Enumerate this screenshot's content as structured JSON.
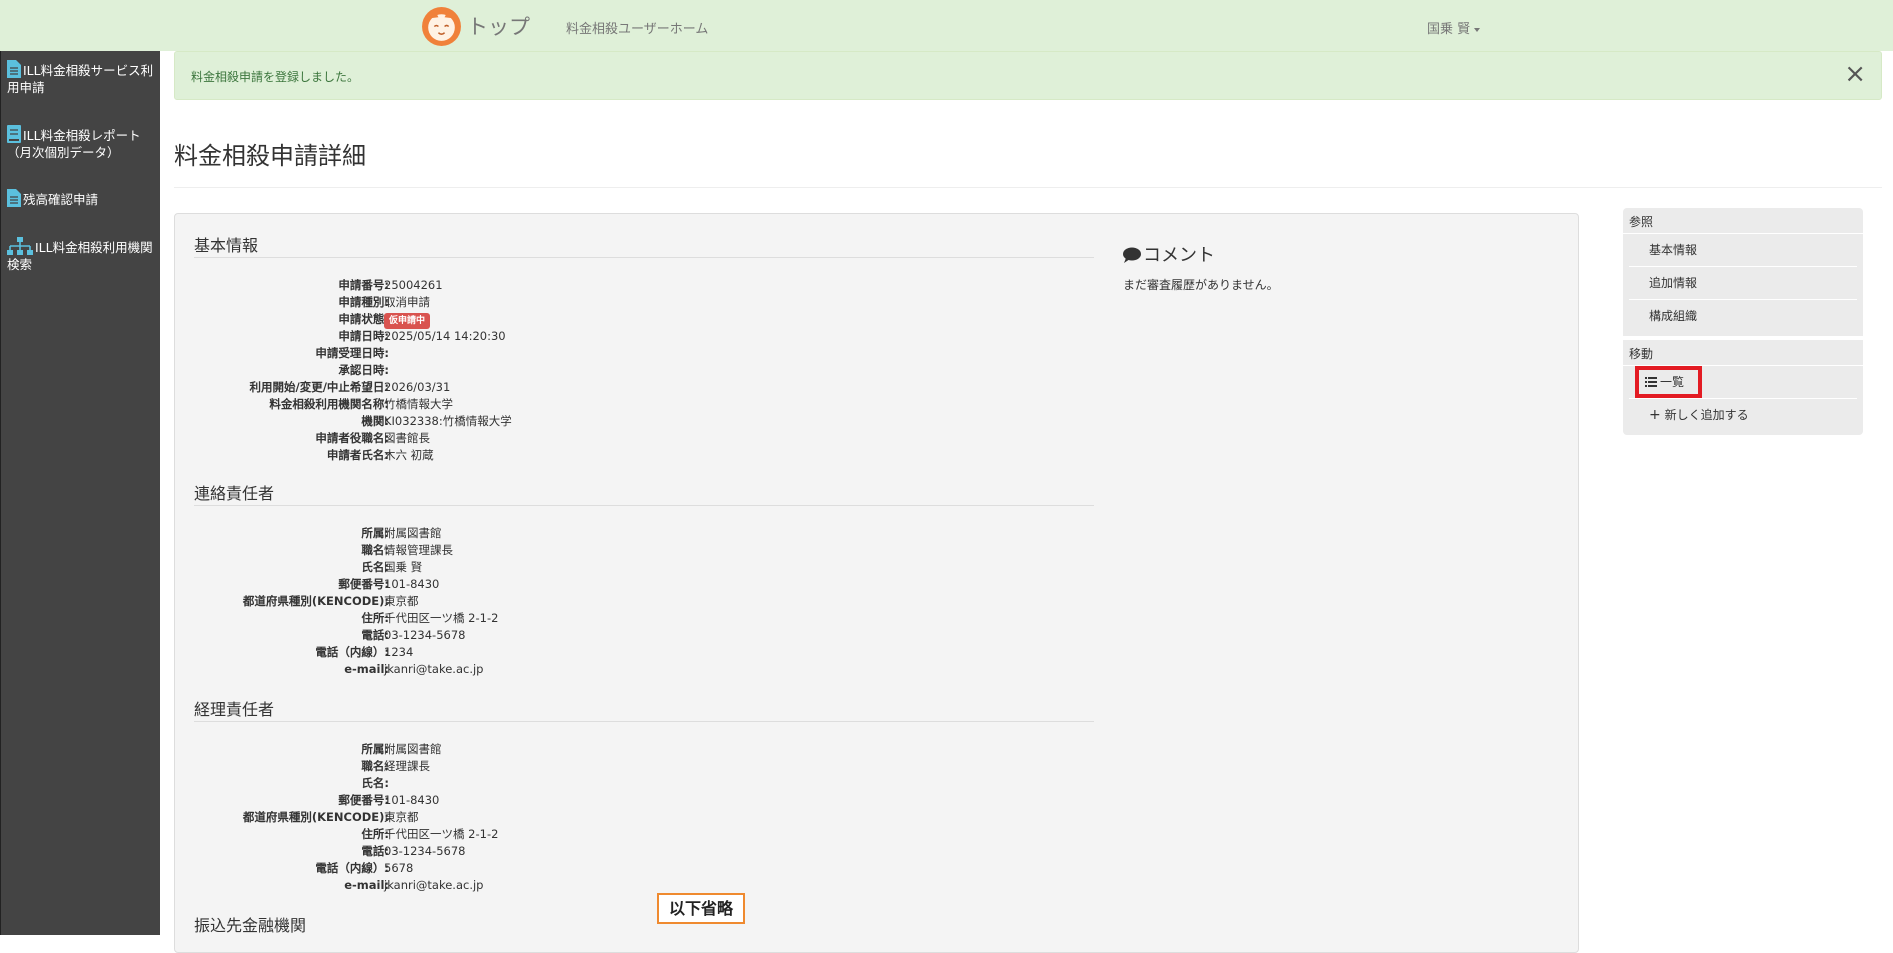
{
  "header": {
    "brand": "トップ",
    "nav_link": "料金相殺ユーザーホーム",
    "user": "国乗 賢"
  },
  "sidebar": {
    "items": [
      {
        "icon": "document-icon",
        "label": "ILL料金相殺サービス利用申請"
      },
      {
        "icon": "report-icon",
        "label": "ILL料金相殺レポート（月次個別データ）"
      },
      {
        "icon": "document-icon",
        "label": "残高確認申請"
      },
      {
        "icon": "sitemap-icon",
        "label": "ILL料金相殺利用機関検索"
      }
    ]
  },
  "alert": {
    "message": "料金相殺申請を登録しました。",
    "close": "×"
  },
  "page_title": "料金相殺申請詳細",
  "basic": {
    "title": "基本情報",
    "fields": [
      {
        "label": "申請番号:",
        "value": "25004261"
      },
      {
        "label": "申請種別:",
        "value": "取消申請"
      },
      {
        "label": "申請状態:",
        "value": "仮申請中"
      },
      {
        "label": "申請日時:",
        "value": "2025/05/14 14:20:30"
      },
      {
        "label": "申請受理日時:",
        "value": ""
      },
      {
        "label": "承認日時:",
        "value": ""
      },
      {
        "label": "利用開始/変更/中止希望日:",
        "value": "2026/03/31"
      },
      {
        "label": "料金相殺利用機関名称:",
        "value": "竹橋情報大学"
      },
      {
        "label": "機関:",
        "value": "KI032338:竹橋情報大学"
      },
      {
        "label": "申請者役職名:",
        "value": "図書館長"
      },
      {
        "label": "申請者氏名:",
        "value": "木六 初蔵"
      }
    ]
  },
  "contact": {
    "title": "連絡責任者",
    "fields": [
      {
        "label": "所属:",
        "value": "附属図書館"
      },
      {
        "label": "職名:",
        "value": "情報管理課長"
      },
      {
        "label": "氏名:",
        "value": "国乗 賢"
      },
      {
        "label": "郵便番号:",
        "value": "101-8430"
      },
      {
        "label": "都道府県種別(KENCODE):",
        "value": "東京都"
      },
      {
        "label": "住所:",
        "value": "千代田区一ツ橋 2-1-2"
      },
      {
        "label": "電話:",
        "value": "03-1234-5678"
      },
      {
        "label": "電話（内線）:",
        "value": "1234"
      },
      {
        "label": "e-mail:",
        "value": "jkanri@take.ac.jp"
      }
    ]
  },
  "accounting": {
    "title": "経理責任者",
    "fields": [
      {
        "label": "所属:",
        "value": "附属図書館"
      },
      {
        "label": "職名:",
        "value": "経理課長"
      },
      {
        "label": "氏名:",
        "value": ""
      },
      {
        "label": "郵便番号:",
        "value": "101-8430"
      },
      {
        "label": "都道府県種別(KENCODE):",
        "value": "東京都"
      },
      {
        "label": "住所:",
        "value": "千代田区一ツ橋 2-1-2"
      },
      {
        "label": "電話:",
        "value": "03-1234-5678"
      },
      {
        "label": "電話（内線）:",
        "value": "5678"
      },
      {
        "label": "e-mail:",
        "value": "jkanri@take.ac.jp"
      }
    ]
  },
  "bank": {
    "title": "振込先金融機関"
  },
  "omitted_note": "以下省略",
  "comment": {
    "title": "コメント",
    "empty": "まだ審査履歴がありません。"
  },
  "right_nav": {
    "reference": {
      "heading": "参照",
      "items": [
        "基本情報",
        "追加情報",
        "構成組織"
      ]
    },
    "move": {
      "heading": "移動",
      "list": "一覧",
      "add": "新しく追加する"
    }
  },
  "colors": {
    "topbar": "#dff0d8",
    "sidebar": "#444444",
    "badge": "#d9534f",
    "highlight_border": "#e31b23",
    "omit_border": "#ef8a2f"
  }
}
